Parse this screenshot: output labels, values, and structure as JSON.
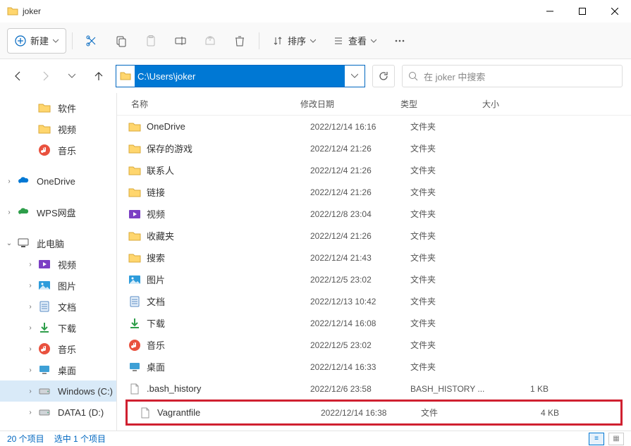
{
  "window": {
    "title": "joker"
  },
  "toolbar": {
    "new": "新建",
    "sort": "排序",
    "view": "查看"
  },
  "nav": {
    "path": "C:\\Users\\joker",
    "search_placeholder": "在 joker 中搜索"
  },
  "sidebar": {
    "quick": [
      {
        "name": "软件",
        "icon": "folder"
      },
      {
        "name": "视频",
        "icon": "folder"
      },
      {
        "name": "音乐",
        "icon": "music"
      }
    ],
    "cloud": [
      {
        "name": "OneDrive",
        "icon": "onedrive",
        "expandable": true
      },
      {
        "name": "WPS网盘",
        "icon": "wps",
        "expandable": true
      }
    ],
    "pc": {
      "name": "此电脑",
      "expanded": true
    },
    "pc_items": [
      {
        "name": "视频",
        "icon": "video"
      },
      {
        "name": "图片",
        "icon": "pictures"
      },
      {
        "name": "文档",
        "icon": "docs"
      },
      {
        "name": "下载",
        "icon": "download"
      },
      {
        "name": "音乐",
        "icon": "music"
      },
      {
        "name": "桌面",
        "icon": "desktop"
      },
      {
        "name": "Windows (C:)",
        "icon": "drive",
        "selected": true
      },
      {
        "name": "DATA1 (D:)",
        "icon": "drive"
      }
    ]
  },
  "columns": {
    "name": "名称",
    "date": "修改日期",
    "type": "类型",
    "size": "大小"
  },
  "files": [
    {
      "name": "OneDrive",
      "date": "2022/12/14 16:16",
      "type": "文件夹",
      "size": "",
      "icon": "folder"
    },
    {
      "name": "保存的游戏",
      "date": "2022/12/4 21:26",
      "type": "文件夹",
      "size": "",
      "icon": "folder"
    },
    {
      "name": "联系人",
      "date": "2022/12/4 21:26",
      "type": "文件夹",
      "size": "",
      "icon": "folder"
    },
    {
      "name": "链接",
      "date": "2022/12/4 21:26",
      "type": "文件夹",
      "size": "",
      "icon": "folder"
    },
    {
      "name": "视频",
      "date": "2022/12/8 23:04",
      "type": "文件夹",
      "size": "",
      "icon": "video"
    },
    {
      "name": "收藏夹",
      "date": "2022/12/4 21:26",
      "type": "文件夹",
      "size": "",
      "icon": "folder"
    },
    {
      "name": "搜索",
      "date": "2022/12/4 21:43",
      "type": "文件夹",
      "size": "",
      "icon": "folder"
    },
    {
      "name": "图片",
      "date": "2022/12/5 23:02",
      "type": "文件夹",
      "size": "",
      "icon": "pictures"
    },
    {
      "name": "文档",
      "date": "2022/12/13 10:42",
      "type": "文件夹",
      "size": "",
      "icon": "docs"
    },
    {
      "name": "下载",
      "date": "2022/12/14 16:08",
      "type": "文件夹",
      "size": "",
      "icon": "download"
    },
    {
      "name": "音乐",
      "date": "2022/12/5 23:02",
      "type": "文件夹",
      "size": "",
      "icon": "music"
    },
    {
      "name": "桌面",
      "date": "2022/12/14 16:33",
      "type": "文件夹",
      "size": "",
      "icon": "desktop"
    },
    {
      "name": ".bash_history",
      "date": "2022/12/6 23:58",
      "type": "BASH_HISTORY ...",
      "size": "1 KB",
      "icon": "file"
    },
    {
      "name": "Vagrantfile",
      "date": "2022/12/14 16:38",
      "type": "文件",
      "size": "4 KB",
      "icon": "file",
      "highlight": true
    }
  ],
  "status": {
    "count": "20 个项目",
    "selected": "选中 1 个项目"
  }
}
